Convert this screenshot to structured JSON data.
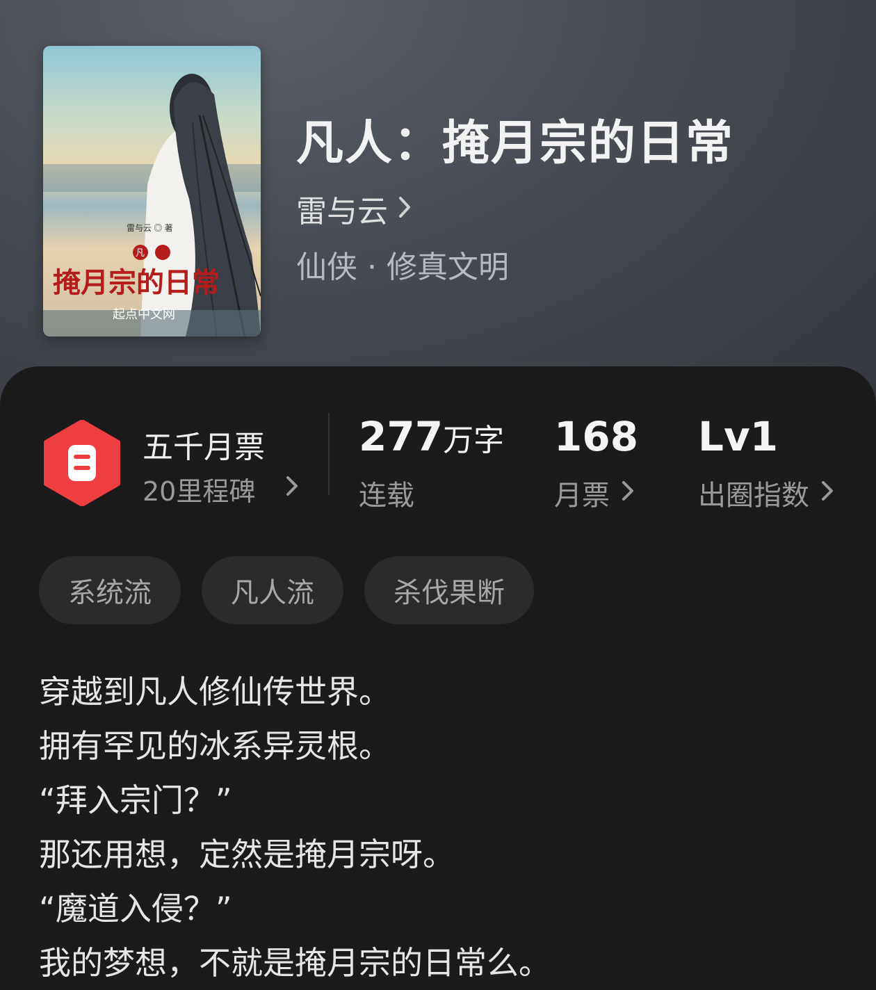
{
  "book": {
    "title": "凡人：掩月宗的日常",
    "author": "雷与云",
    "genre": "仙侠 · 修真文明",
    "cover": {
      "author_line": "雷与云 ◎ 著",
      "pre_title": "凡 人",
      "title": "掩月宗的日常",
      "publisher": "起点中文网"
    }
  },
  "milestone": {
    "title": "五千月票",
    "subtitle": "20里程碑"
  },
  "stats": [
    {
      "value": "277",
      "unit": "万字",
      "label": "连载"
    },
    {
      "value": "168",
      "unit": "",
      "label": "月票"
    },
    {
      "value": "Lv1",
      "unit": "",
      "label": "出圈指数"
    }
  ],
  "tags": [
    "系统流",
    "凡人流",
    "杀伐果断"
  ],
  "synopsis": [
    "穿越到凡人修仙传世界。",
    "拥有罕见的冰系异灵根。",
    "“拜入宗门？”",
    "那还用想，定然是掩月宗呀。",
    "“魔道入侵？”",
    "我的梦想，不就是掩月宗的日常么。"
  ],
  "colors": {
    "badge": "#ef3e42",
    "cover_title": "#b51d1d"
  }
}
